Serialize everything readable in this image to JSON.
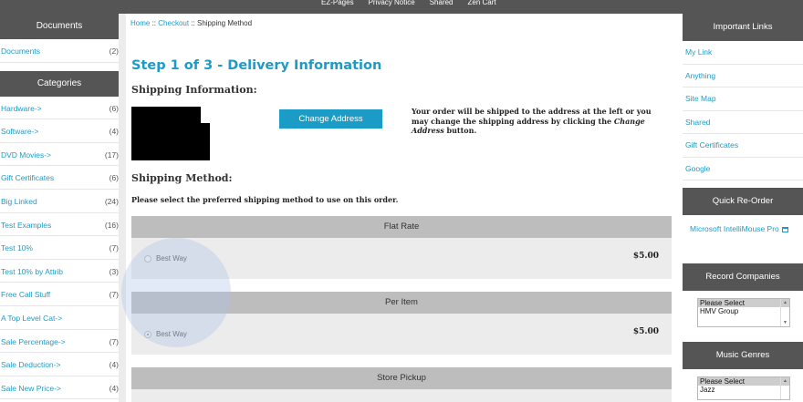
{
  "topnav": {
    "links": [
      "EZ-Pages",
      "Privacy Notice",
      "Shared",
      "Zen Cart"
    ]
  },
  "left": {
    "documents_title": "Documents",
    "documents": [
      {
        "label": "Documents",
        "count": "(2)"
      }
    ],
    "categories_title": "Categories",
    "categories": [
      {
        "label": "Hardware->",
        "count": "(6)"
      },
      {
        "label": "Software->",
        "count": "(4)"
      },
      {
        "label": "DVD Movies->",
        "count": "(17)"
      },
      {
        "label": "Gift Certificates",
        "count": "(6)"
      },
      {
        "label": "Big Linked",
        "count": "(24)"
      },
      {
        "label": "Test Examples",
        "count": "(16)"
      },
      {
        "label": "Test 10%",
        "count": "(7)"
      },
      {
        "label": "Test 10% by Attrib",
        "count": "(3)"
      },
      {
        "label": "Free Call Stuff",
        "count": "(7)"
      },
      {
        "label": "A Top Level Cat->",
        "count": ""
      },
      {
        "label": "Sale Percentage->",
        "count": "(7)"
      },
      {
        "label": "Sale Deduction->",
        "count": "(4)"
      },
      {
        "label": "Sale New Price->",
        "count": "(4)"
      }
    ]
  },
  "main": {
    "breadcrumb": {
      "home": "Home",
      "sep": "::",
      "checkout": "Checkout",
      "current": "Shipping Method"
    },
    "step_title": "Step 1 of 3 - Delivery Information",
    "shipping_info_title": "Shipping Information:",
    "change_address_label": "Change Address",
    "address_note_1": "Your order will be shipped to the address at the left or you may change the shipping address by clicking the ",
    "address_note_em": "Change Address",
    "address_note_2": " button.",
    "shipping_method_title": "Shipping Method:",
    "method_note": "Please select the preferred shipping method to use on this order.",
    "methods": [
      {
        "name": "Flat Rate",
        "option": "Best Way",
        "price": "$5.00",
        "selected": false
      },
      {
        "name": "Per Item",
        "option": "Best Way",
        "price": "$5.00",
        "selected": true
      },
      {
        "name": "Store Pickup"
      }
    ]
  },
  "right": {
    "important_title": "Important Links",
    "important_links": [
      "My Link",
      "Anything",
      "Site Map",
      "Shared",
      "Gift Certificates",
      "Google"
    ],
    "reorder_title": "Quick Re-Order",
    "reorder_product": "Microsoft IntelliMouse Pro",
    "record_title": "Record Companies",
    "record_options": [
      "Please Select",
      "HMV Group"
    ],
    "genres_title": "Music Genres",
    "genre_options": [
      "Please Select",
      "Jazz"
    ]
  },
  "colors": {
    "accent": "#1e9bc4",
    "header_bg": "#555555",
    "button_bg": "#1a9cc6"
  }
}
